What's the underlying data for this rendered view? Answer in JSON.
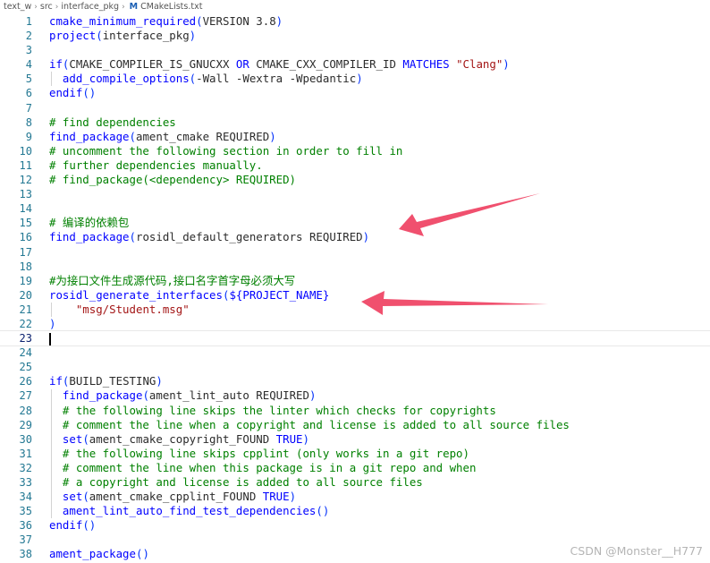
{
  "breadcrumb": {
    "folder": "text_w",
    "sub1": "src",
    "sub2": "interface_pkg",
    "file_icon": "M",
    "file": "CMakeLists.txt"
  },
  "lines": [
    {
      "n": "1",
      "code": "cmake_minimum_required(VERSION 3.8)"
    },
    {
      "n": "2",
      "code": "project(interface_pkg)"
    },
    {
      "n": "3",
      "code": ""
    },
    {
      "n": "4",
      "code": "if(CMAKE_COMPILER_IS_GNUCXX OR CMAKE_CXX_COMPILER_ID MATCHES \"Clang\")"
    },
    {
      "n": "5",
      "code": "  add_compile_options(-Wall -Wextra -Wpedantic)"
    },
    {
      "n": "6",
      "code": "endif()"
    },
    {
      "n": "7",
      "code": ""
    },
    {
      "n": "8",
      "code": "# find dependencies"
    },
    {
      "n": "9",
      "code": "find_package(ament_cmake REQUIRED)"
    },
    {
      "n": "10",
      "code": "# uncomment the following section in order to fill in"
    },
    {
      "n": "11",
      "code": "# further dependencies manually."
    },
    {
      "n": "12",
      "code": "# find_package(<dependency> REQUIRED)"
    },
    {
      "n": "13",
      "code": ""
    },
    {
      "n": "14",
      "code": ""
    },
    {
      "n": "15",
      "code": "# 编译的依赖包"
    },
    {
      "n": "16",
      "code": "find_package(rosidl_default_generators REQUIRED)"
    },
    {
      "n": "17",
      "code": ""
    },
    {
      "n": "18",
      "code": ""
    },
    {
      "n": "19",
      "code": "#为接口文件生成源代码,接口名字首字母必须大写"
    },
    {
      "n": "20",
      "code": "rosidl_generate_interfaces(${PROJECT_NAME}"
    },
    {
      "n": "21",
      "code": "    \"msg/Student.msg\""
    },
    {
      "n": "22",
      "code": ")"
    },
    {
      "n": "23",
      "code": ""
    },
    {
      "n": "24",
      "code": ""
    },
    {
      "n": "25",
      "code": ""
    },
    {
      "n": "26",
      "code": "if(BUILD_TESTING)"
    },
    {
      "n": "27",
      "code": "  find_package(ament_lint_auto REQUIRED)"
    },
    {
      "n": "28",
      "code": "  # the following line skips the linter which checks for copyrights"
    },
    {
      "n": "29",
      "code": "  # comment the line when a copyright and license is added to all source files"
    },
    {
      "n": "30",
      "code": "  set(ament_cmake_copyright_FOUND TRUE)"
    },
    {
      "n": "31",
      "code": "  # the following line skips cpplint (only works in a git repo)"
    },
    {
      "n": "32",
      "code": "  # comment the line when this package is in a git repo and when"
    },
    {
      "n": "33",
      "code": "  # a copyright and license is added to all source files"
    },
    {
      "n": "34",
      "code": "  set(ament_cmake_cpplint_FOUND TRUE)"
    },
    {
      "n": "35",
      "code": "  ament_lint_auto_find_test_dependencies()"
    },
    {
      "n": "36",
      "code": "endif()"
    },
    {
      "n": "37",
      "code": ""
    },
    {
      "n": "38",
      "code": "ament_package()"
    }
  ],
  "watermark": "CSDN @Monster__H777",
  "colors": {
    "arrow": "#f0506e",
    "line_number": "#237893",
    "comment": "#008000",
    "function": "#0000ff",
    "string": "#a31515"
  }
}
